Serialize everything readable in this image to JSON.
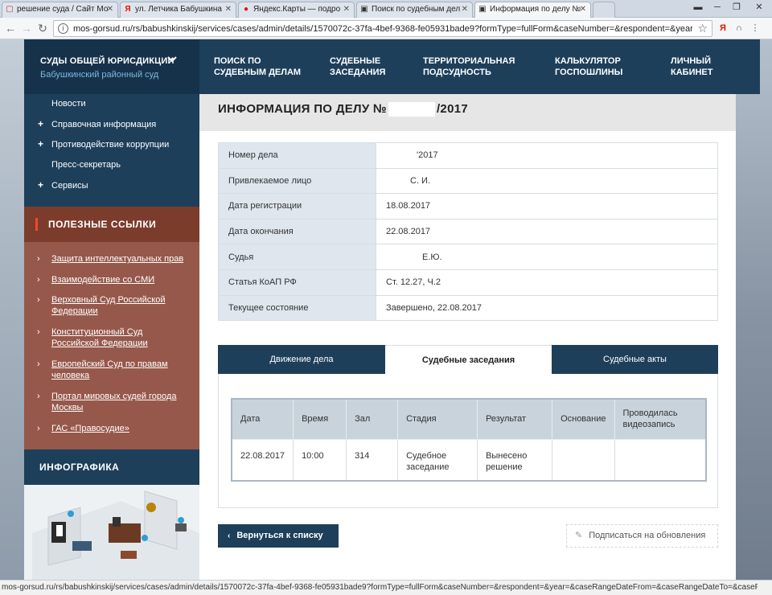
{
  "browser": {
    "tabs": [
      {
        "icon": "mosgorsud-icon",
        "favicon_char": "▢",
        "favicon_color": "#c0392b",
        "label": "решение суда / Сайт Мо"
      },
      {
        "icon": "yandex-icon",
        "favicon_char": "Я",
        "favicon_color": "#e61400",
        "label": "ул. Летчика Бабушкина"
      },
      {
        "icon": "yandex-maps-icon",
        "favicon_char": "●",
        "favicon_color": "#e61400",
        "label": "Яндекс.Карты — подро"
      },
      {
        "icon": "site-icon",
        "favicon_char": "▣",
        "favicon_color": "#333333",
        "label": "Поиск по судебным дел"
      },
      {
        "icon": "site-icon",
        "favicon_char": "▣",
        "favicon_color": "#333333",
        "label": "Информация по делу №"
      }
    ],
    "url": "mos-gorsud.ru/rs/babushkinskij/services/cases/admin/details/1570072c-37fa-4bef-9368-fe05931bade9?formType=fullForm&caseNumber=&respondent=&year=&c...",
    "status_url": "mos-gorsud.ru/rs/babushkinskij/services/cases/admin/details/1570072c-37fa-4bef-9368-fe05931bade9?formType=fullForm&caseNumber=&respondent=&year=&caseRangeDateFrom=&caseRangeDateTo=&caseFinalRangeDateFrom..."
  },
  "header": {
    "brand_title": "СУДЫ ОБЩЕЙ ЮРИСДИКЦИИ",
    "brand_subtitle": "Бабушкинский районный суд",
    "nav": [
      {
        "line1": "ПОИСК ПО",
        "line2": "СУДЕБНЫМ ДЕЛАМ"
      },
      {
        "line1": "СУДЕБНЫЕ",
        "line2": "ЗАСЕДАНИЯ"
      },
      {
        "line1": "ТЕРРИТОРИАЛЬНАЯ",
        "line2": "ПОДСУДНОСТЬ"
      },
      {
        "line1": "КАЛЬКУЛЯТОР",
        "line2": "ГОСПОШЛИНЫ"
      },
      {
        "line1": "ЛИЧНЫЙ",
        "line2": "КАБИНЕТ"
      }
    ]
  },
  "sidebar": {
    "menu": [
      {
        "label": "Новости",
        "plus": false
      },
      {
        "label": "Справочная информация",
        "plus": true
      },
      {
        "label": "Противодействие коррупции",
        "plus": true
      },
      {
        "label": "Пресс-секретарь",
        "plus": false
      },
      {
        "label": "Сервисы",
        "plus": true
      }
    ],
    "useful_title": "ПОЛЕЗНЫЕ ССЫЛКИ",
    "links": [
      {
        "line1": "Защита интеллектуальных прав",
        "line2": ""
      },
      {
        "line1": "Взаимодействие со СМИ",
        "line2": ""
      },
      {
        "line1": "Верховный Суд Российской",
        "line2": "Федерации"
      },
      {
        "line1": "Конституционный Суд",
        "line2": "Российской Федерации"
      },
      {
        "line1": "Европейский Суд по правам",
        "line2": "человека"
      },
      {
        "line1": "Портал мировых судей города",
        "line2": "Москвы"
      },
      {
        "line1": "ГАС «Правосудие»",
        "line2": ""
      }
    ],
    "infographic_title": "ИНФОГРАФИКА"
  },
  "main": {
    "title_prefix": "ИНФОРМАЦИЯ ПО ДЕЛУ №",
    "title_suffix": "/2017",
    "details": [
      {
        "key": "Номер дела",
        "value": "'2017"
      },
      {
        "key": "Привлекаемое лицо",
        "value": "С. И."
      },
      {
        "key": "Дата регистрации",
        "value": "18.08.2017"
      },
      {
        "key": "Дата окончания",
        "value": "22.08.2017"
      },
      {
        "key": "Судья",
        "value": "Е.Ю."
      },
      {
        "key": "Статья КоАП РФ",
        "value": "Ст. 12.27, Ч.2"
      },
      {
        "key": "Текущее состояние",
        "value": "Завершено, 22.08.2017"
      }
    ],
    "tabs": [
      "Движение дела",
      "Судебные заседания",
      "Судебные акты"
    ],
    "active_tab": 1,
    "hearings": {
      "headers": [
        "Дата",
        "Время",
        "Зал",
        "Стадия",
        "Результат",
        "Основание",
        "Проводилась видеозапись"
      ],
      "rows": [
        [
          "22.08.2017",
          "10:00",
          "314",
          "Судебное заседание",
          "Вынесено решение",
          "",
          ""
        ]
      ]
    },
    "back_label": "Вернуться к списку",
    "subscribe_label": "Подписаться на обновления"
  },
  "colors": {
    "nav_dark": "#1d3f5a",
    "brand_dark": "#16324a",
    "links_bg": "#96584a",
    "links_head_bg": "#7c3c2c",
    "accent_red": "#e84c2c",
    "subtitle_blue": "#7fb6e0"
  }
}
